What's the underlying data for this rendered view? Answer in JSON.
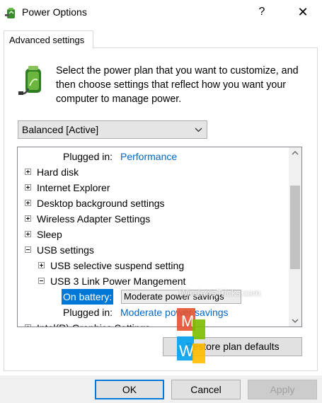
{
  "window": {
    "title": "Power Options",
    "help_label": "?",
    "close_label": "✕"
  },
  "tabs": [
    {
      "label": "Advanced settings"
    }
  ],
  "description": "Select the power plan that you want to customize, and then choose settings that reflect how you want your computer to manage power.",
  "plan_select": {
    "value": "Balanced [Active]"
  },
  "tree": {
    "rows": [
      {
        "label": "Plugged in:",
        "value": "Performance"
      },
      {
        "label": "Hard disk",
        "expander": "plus"
      },
      {
        "label": "Internet Explorer",
        "expander": "plus"
      },
      {
        "label": "Desktop background settings",
        "expander": "plus"
      },
      {
        "label": "Wireless Adapter Settings",
        "expander": "plus"
      },
      {
        "label": "Sleep",
        "expander": "plus"
      },
      {
        "label": "USB settings",
        "expander": "minus"
      },
      {
        "label": "USB selective suspend setting",
        "expander": "plus"
      },
      {
        "label": "USB 3 Link Power Mangement",
        "expander": "minus"
      },
      {
        "label": "On battery:",
        "value": "Moderate power savings"
      },
      {
        "label": "Plugged in:",
        "value": "Moderate power savings"
      },
      {
        "label": "Intel(R) Graphics Settings",
        "expander": "plus"
      }
    ]
  },
  "buttons": {
    "restore": "Restore plan defaults",
    "ok": "OK",
    "cancel": "Cancel",
    "apply": "Apply"
  },
  "watermark": {
    "text": "WindowsTricks.com",
    "logo_letters": [
      "M",
      "W"
    ]
  },
  "colors": {
    "accent": "#0078d7",
    "link": "#0066cc",
    "logo_red": "#e2522f",
    "logo_green": "#7cbb00",
    "logo_blue": "#00a1f1",
    "logo_yellow": "#ffbb00"
  }
}
